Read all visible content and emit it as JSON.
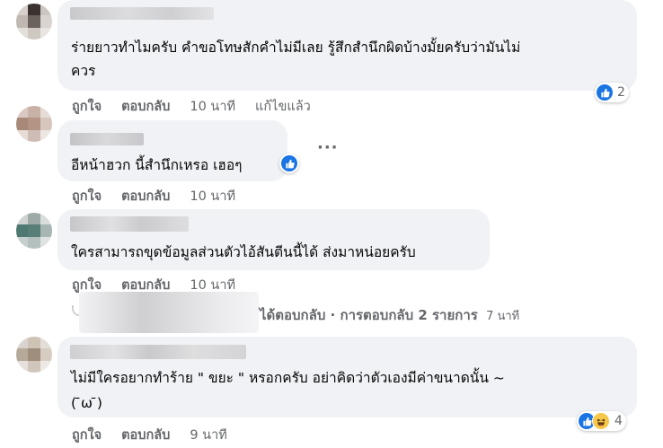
{
  "comments": [
    {
      "text_line1": "ร่ายยาวทำไมครับ คำขอโทษสักคำไม่มีเลย รู้สึกสำนึกผิดบ้างมั้ยครับว่ามันไม่",
      "text_line2": "ควร",
      "like_label": "ถูกใจ",
      "reply_label": "ตอบกลับ",
      "time": "10 นาที",
      "edited": "แก้ไขแล้ว",
      "reaction_icons": [
        "like-icon"
      ],
      "reaction_count": "2"
    },
    {
      "text_line1": "อีหน้าฮวก นี้สำนึกเหรอ เฮอๆ",
      "like_label": "ถูกใจ",
      "reply_label": "ตอบกลับ",
      "time": "10 นาที",
      "reaction_icons": [
        "like-icon"
      ],
      "more_label": "···"
    },
    {
      "text_line1": "ใครสามารถขุดข้อมูลส่วนตัวไอ้สันตีนนี้ได้ ส่งมาหน่อยครับ",
      "like_label": "ถูกใจ",
      "reply_label": "ตอบกลับ",
      "time": "10 นาที",
      "replies_summary": "ได้ตอบกลับ · การตอบกลับ 2 รายการ",
      "replies_time": "7 นาที"
    },
    {
      "text_line1": "ไม่มีใครอยากทำร้าย \" ขยะ \" หรอกครับ อย่าคิดว่าตัวเองมีค่าขนาดนั้น ~",
      "text_line2": "( ̄ω ̄)",
      "like_label": "ถูกใจ",
      "reply_label": "ตอบกลับ",
      "time": "9 นาที",
      "reaction_icons": [
        "like-icon",
        "haha-icon"
      ],
      "reaction_count": "4"
    }
  ],
  "colors": {
    "bubble": "#f0f2f5",
    "meta_text": "#65676b",
    "like_blue": "#1b74e4",
    "haha_yellow": "#f7c74a"
  }
}
